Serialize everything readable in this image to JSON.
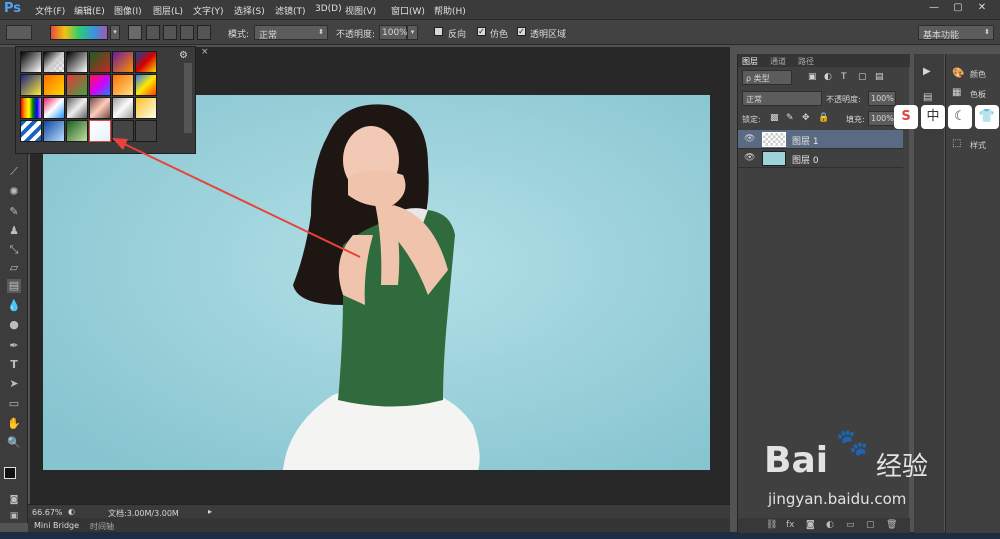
{
  "app": {
    "logo": "Ps"
  },
  "menu": [
    "文件(F)",
    "编辑(E)",
    "图像(I)",
    "图层(L)",
    "文字(Y)",
    "选择(S)",
    "滤镜(T)",
    "3D(D)",
    "视图(V)",
    "窗口(W)",
    "帮助(H)"
  ],
  "window_controls": [
    "—",
    "▢",
    "✕"
  ],
  "options": {
    "mode_label": "模式:",
    "mode_value": "正常",
    "opacity_label": "不透明度:",
    "opacity_value": "100%",
    "reverse_label": "反向",
    "dither_label": "仿色",
    "transparency_label": "透明区域",
    "workspace": "基本功能"
  },
  "status": {
    "zoom": "66.67%",
    "doc": "文档:3.00M/3.00M"
  },
  "bottom_tabs": [
    "Mini Bridge",
    "时间轴"
  ],
  "layers_panel": {
    "tabs": [
      "图层",
      "通道",
      "路径"
    ],
    "filter_label": "ρ 类型",
    "blend_mode": "正常",
    "opacity_label": "不透明度:",
    "opacity_value": "100%",
    "lock_label": "锁定:",
    "fill_label": "填充:",
    "fill_value": "100%",
    "layers": [
      {
        "name": "图层 1"
      },
      {
        "name": "图层 0"
      }
    ]
  },
  "right_panel": {
    "items": [
      "颜色",
      "色板",
      "样式"
    ]
  },
  "ime_toolbar": [
    "S",
    "中",
    "☾",
    "👕"
  ],
  "watermark": {
    "brand": "Bai",
    "brand2": "经验",
    "url": "jingyan.baidu.com"
  },
  "colors": {
    "accent": "#e8433a",
    "canvas_bg": "#9fd3db",
    "shirt": "#2f6b3c"
  }
}
